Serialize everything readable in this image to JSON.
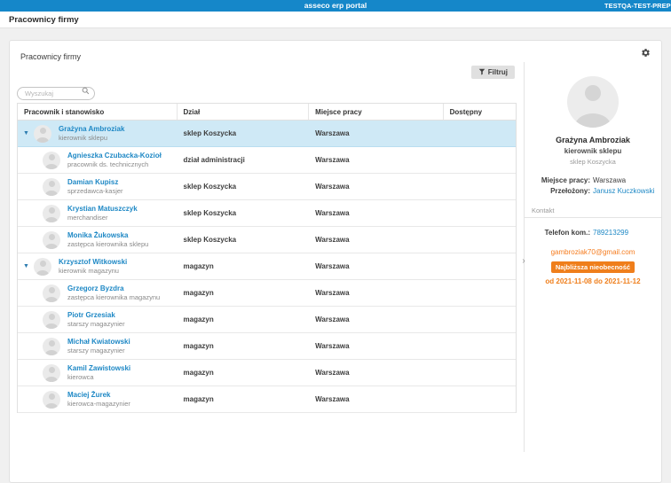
{
  "app_bar": {
    "title": "asseco erp portal",
    "environment": "TESTQA-TEST-PREPR"
  },
  "breadcrumb": "Pracownicy firmy",
  "card": {
    "title": "Pracownicy firmy",
    "filter_button_label": "Filtruj",
    "search_placeholder": "Wyszukaj"
  },
  "table": {
    "columns": [
      "Pracownik i stanowisko",
      "Dział",
      "Miejsce pracy",
      "Dostępny"
    ],
    "rows": [
      {
        "name": "Grażyna Ambroziak",
        "position": "kierownik sklepu",
        "department": "sklep Koszycka",
        "location": "Warszawa",
        "available": "",
        "group": true,
        "selected": true
      },
      {
        "name": "Agnieszka Czubacka-Kozioł",
        "position": "pracownik ds. technicznych",
        "department": "dział administracji",
        "location": "Warszawa",
        "available": "",
        "group": false,
        "selected": false
      },
      {
        "name": "Damian Kupisz",
        "position": "sprzedawca-kasjer",
        "department": "sklep Koszycka",
        "location": "Warszawa",
        "available": "",
        "group": false,
        "selected": false
      },
      {
        "name": "Krystian Matuszczyk",
        "position": "merchandiser",
        "department": "sklep Koszycka",
        "location": "Warszawa",
        "available": "",
        "group": false,
        "selected": false
      },
      {
        "name": "Monika Żukowska",
        "position": "zastępca kierownika sklepu",
        "department": "sklep Koszycka",
        "location": "Warszawa",
        "available": "",
        "group": false,
        "selected": false
      },
      {
        "name": "Krzysztof Witkowski",
        "position": "kierownik magazynu",
        "department": "magazyn",
        "location": "Warszawa",
        "available": "",
        "group": true,
        "selected": false
      },
      {
        "name": "Grzegorz Byzdra",
        "position": "zastępca kierownika magazynu",
        "department": "magazyn",
        "location": "Warszawa",
        "available": "",
        "group": false,
        "selected": false
      },
      {
        "name": "Piotr Grzesiak",
        "position": "starszy magazynier",
        "department": "magazyn",
        "location": "Warszawa",
        "available": "",
        "group": false,
        "selected": false
      },
      {
        "name": "Michał Kwiatowski",
        "position": "starszy magazynier",
        "department": "magazyn",
        "location": "Warszawa",
        "available": "",
        "group": false,
        "selected": false
      },
      {
        "name": "Kamil Zawistowski",
        "position": "kierowca",
        "department": "magazyn",
        "location": "Warszawa",
        "available": "",
        "group": false,
        "selected": false
      },
      {
        "name": "Maciej Żurek",
        "position": "kierowca-magazynier",
        "department": "magazyn",
        "location": "Warszawa",
        "available": "",
        "group": false,
        "selected": false
      }
    ]
  },
  "detail_panel": {
    "name": "Grażyna Ambroziak",
    "position": "kierownik sklepu",
    "department": "sklep Koszycka",
    "workplace_label": "Miejsce pracy:",
    "workplace_value": "Warszawa",
    "supervisor_label": "Przełożony:",
    "supervisor_value": "Janusz Kuczkowski",
    "contact_section_label": "Kontakt",
    "phone_label": "Telefon kom.:",
    "phone_value": "789213299",
    "email": "gambroziak70@gmail.com",
    "absence_badge": "Najbliższa nieobecność",
    "absence_dates": "od 2021-11-08 do 2021-11-12",
    "expander_glyph": "›"
  },
  "colors": {
    "primary_blue": "#1587c9",
    "link_blue": "#1e88c5",
    "orange": "#ef7e1b",
    "selected_row_bg": "#cfe9f6"
  }
}
